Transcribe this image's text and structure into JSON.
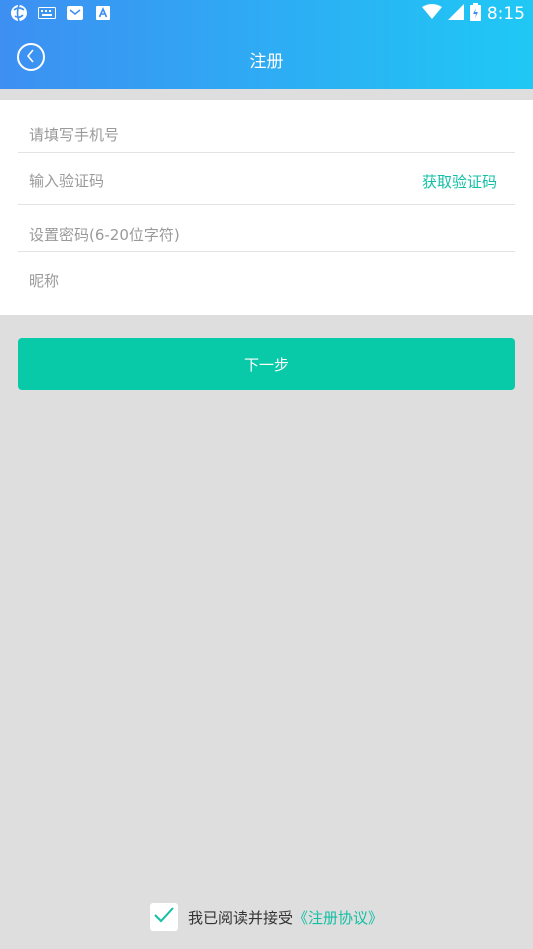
{
  "status_bar": {
    "time": "8:15",
    "icons": [
      "vpn-globe-icon",
      "keyboard-icon",
      "mail-icon",
      "font-a-icon",
      "wifi-icon",
      "signal-icon",
      "battery-icon"
    ]
  },
  "header": {
    "title": "注册",
    "back_icon": "back-arrow-icon"
  },
  "form": {
    "phone_placeholder": "请填写手机号",
    "phone_value": "",
    "code_placeholder": "输入验证码",
    "code_value": "",
    "get_code_label": "获取验证码",
    "password_placeholder": "设置密码(6-20位字符)",
    "password_value": "",
    "nickname_placeholder": "昵称",
    "nickname_value": ""
  },
  "next_button": {
    "label": "下一步"
  },
  "agreement": {
    "checked": true,
    "text": "我已阅读并接受",
    "link": "《注册协议》"
  },
  "colors": {
    "header_gradient_start": "#3d8ff2",
    "header_gradient_end": "#1fc8f5",
    "accent": "#08c9a8",
    "link": "#12bfa4",
    "background": "#dedede"
  }
}
